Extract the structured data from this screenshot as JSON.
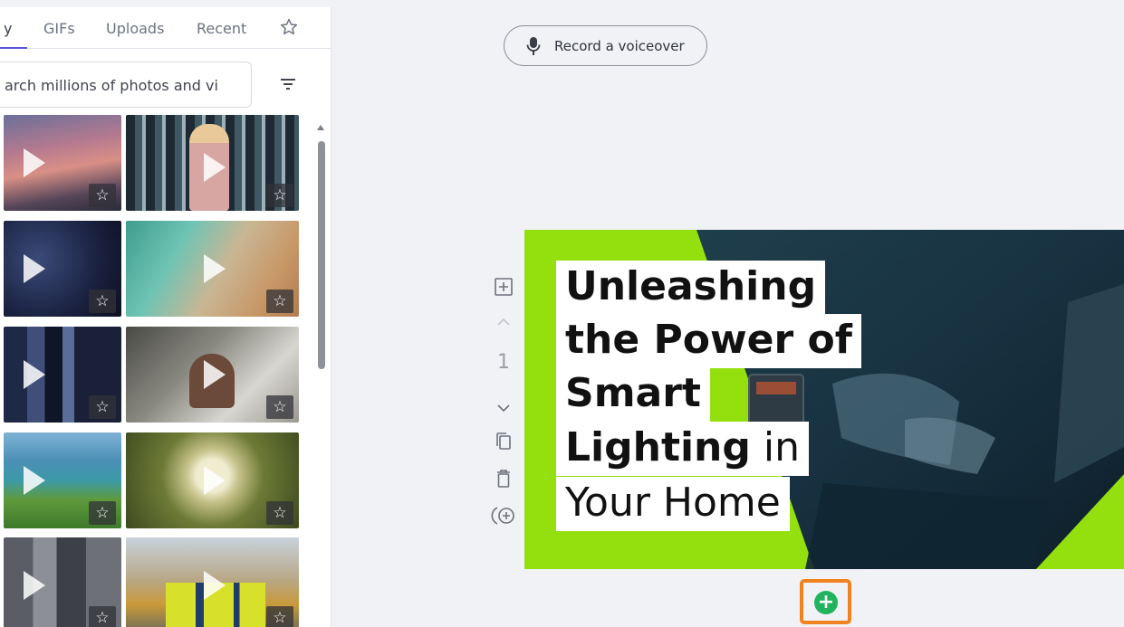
{
  "media_panel": {
    "tabs": [
      {
        "label": "y",
        "active": true
      },
      {
        "label": "GIFs",
        "active": false
      },
      {
        "label": "Uploads",
        "active": false
      },
      {
        "label": "Recent",
        "active": false
      }
    ],
    "favorites_tab_icon": "star-icon",
    "search": {
      "value": "arch millions of photos and vi"
    },
    "filter_icon": "filter-icon",
    "thumbnails": [
      {
        "subject": "sunset-clouds",
        "type": "video",
        "favorite_icon": "star-icon",
        "favorite_label": "☆"
      },
      {
        "subject": "woman-with-phone",
        "type": "video",
        "favorite_icon": "star-icon",
        "favorite_label": "☆"
      },
      {
        "subject": "dark-water-drops",
        "type": "video",
        "favorite_icon": "star-icon",
        "favorite_label": "☆"
      },
      {
        "subject": "aerial-beach",
        "type": "video",
        "favorite_icon": "star-icon",
        "favorite_label": "☆"
      },
      {
        "subject": "city-skyscrapers",
        "type": "video",
        "favorite_icon": "star-icon",
        "favorite_label": "☆"
      },
      {
        "subject": "man-at-desk",
        "type": "video",
        "favorite_icon": "star-icon",
        "favorite_label": "☆"
      },
      {
        "subject": "mountain-lake",
        "type": "video",
        "favorite_icon": "star-icon",
        "favorite_label": "☆"
      },
      {
        "subject": "white-flowers",
        "type": "video",
        "favorite_icon": "star-icon",
        "favorite_label": "☆"
      },
      {
        "subject": "city-street",
        "type": "video",
        "favorite_icon": "star-icon",
        "favorite_label": "☆"
      },
      {
        "subject": "construction-workers",
        "type": "video",
        "favorite_icon": "star-icon",
        "favorite_label": "☆"
      }
    ]
  },
  "toolbar": {
    "voiceover_label": "Record a voiceover",
    "voiceover_icon": "microphone-icon"
  },
  "scene_tools": {
    "scene_number": "1",
    "icons": [
      "add-text-icon",
      "chevron-up-icon",
      "chevron-down-icon",
      "duplicate-icon",
      "delete-icon",
      "add-media-icon"
    ]
  },
  "scene": {
    "caption_lines": [
      {
        "bold": "Unleashing",
        "regular": ""
      },
      {
        "bold": "the Power of",
        "regular": ""
      },
      {
        "bold": "Smart",
        "regular": ""
      },
      {
        "bold": "Lighting",
        "regular": " in"
      },
      {
        "bold": "",
        "regular": "Your Home"
      }
    ],
    "accent_color": "#94e00f"
  },
  "add_scene": {
    "icon": "plus-icon",
    "label": "+",
    "highlight_color": "#f0831e"
  }
}
